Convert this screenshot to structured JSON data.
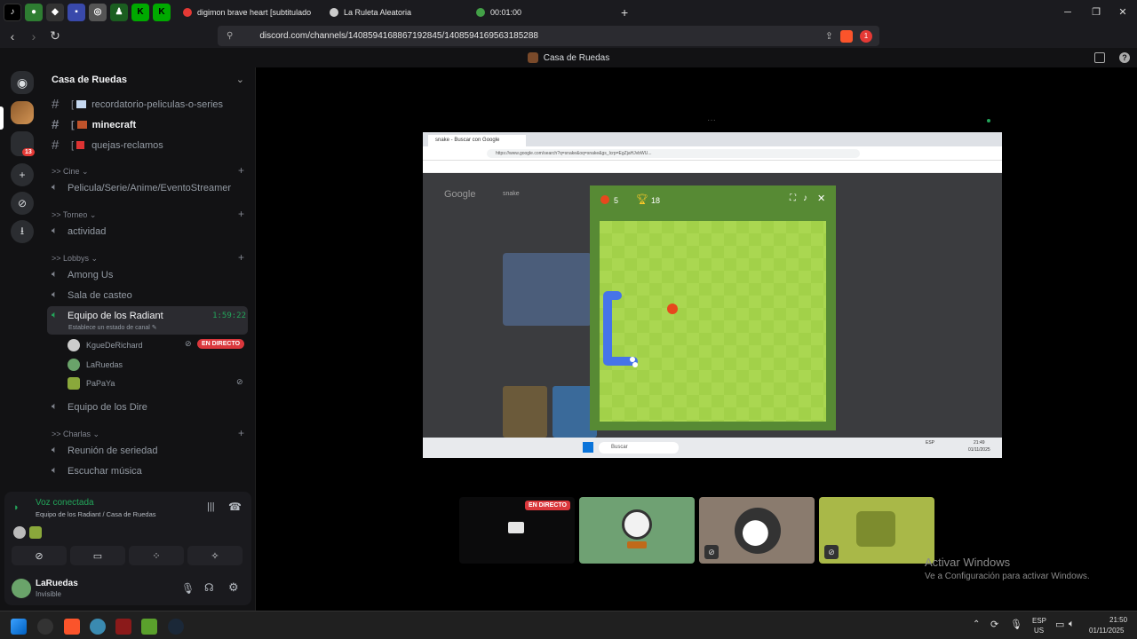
{
  "browser": {
    "tabs": [
      {
        "label": "digimon brave heart [subtitulado",
        "color": "#e53935"
      },
      {
        "label": "La Ruleta Aleatoria",
        "color": "#cccccc"
      },
      {
        "label": "00:01:00",
        "color": "#43a047"
      }
    ],
    "url": "discord.com/channels/1408594168867192845/1408594169563185288",
    "badge": "1"
  },
  "discord": {
    "window_title": "Casa de Ruedas",
    "server_name": "Casa de Ruedas",
    "rail_badge": "13",
    "text_channels": [
      {
        "name": "recordatorio-peliculas-o-series",
        "active": false
      },
      {
        "name": "minecraft",
        "active": true
      },
      {
        "name": "quejas-reclamos",
        "active": false
      }
    ],
    "categories": {
      "cine": ">> Cine",
      "torneo": ">> Torneo",
      "lobbys": ">> Lobbys",
      "charlas": ">> Charlas"
    },
    "voice_channels": {
      "cine": "Pelicula/Serie/Anime/EventoStreamer",
      "torneo": "actividad",
      "among": "Among Us",
      "casteo": "Sala de casteo",
      "radiant": "Equipo de los Radiant",
      "dire": "Equipo de los Dire",
      "seriedad": "Reunión de seriedad",
      "musica": "Escuchar música"
    },
    "radiant_timer": "1:59:22",
    "radiant_status": "Establece un estado de canal",
    "voice_users": [
      {
        "name": "KgueDeRichard",
        "live": "EN DIRECTO"
      },
      {
        "name": "LaRuedas"
      },
      {
        "name": "PaPaYa"
      }
    ],
    "voice_panel": {
      "status": "Voz conectada",
      "location": "Equipo de los Radiant / Casa de Ruedas"
    },
    "user": {
      "name": "LaRuedas",
      "status": "Invisible"
    }
  },
  "stream": {
    "live_label": "EN DIRECTO",
    "inner_tab": "snake - Buscar con Google",
    "inner_url": "https://www.google.com/search?q=snake&oq=snake&gs_lcrp=EgZjaHJvbWU...",
    "google_search": "snake",
    "snake_score": "5",
    "snake_best": "18",
    "inner_search": "Buscar",
    "inner_lang": "ESP",
    "inner_time": "21:49",
    "inner_date": "01/11/2025"
  },
  "watermark": {
    "title": "Activar Windows",
    "subtitle": "Ve a Configuración para activar Windows."
  },
  "taskbar": {
    "lang_top": "ESP",
    "lang_bottom": "US",
    "time": "21:50",
    "date": "01/11/2025"
  }
}
